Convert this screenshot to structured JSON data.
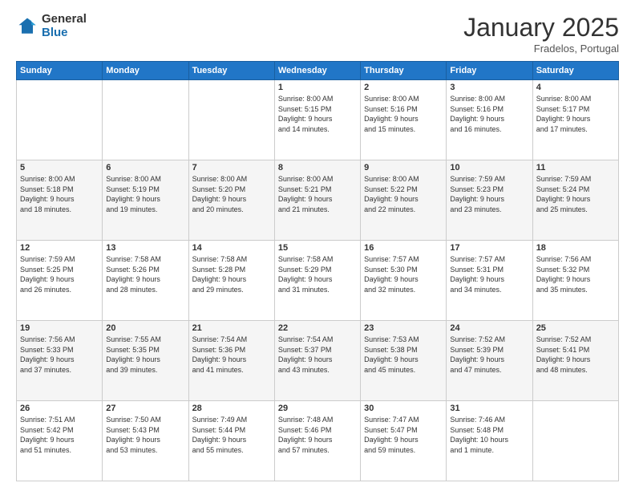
{
  "header": {
    "logo_general": "General",
    "logo_blue": "Blue",
    "month_title": "January 2025",
    "location": "Fradelos, Portugal"
  },
  "days_of_week": [
    "Sunday",
    "Monday",
    "Tuesday",
    "Wednesday",
    "Thursday",
    "Friday",
    "Saturday"
  ],
  "weeks": [
    [
      {
        "day": "",
        "info": ""
      },
      {
        "day": "",
        "info": ""
      },
      {
        "day": "",
        "info": ""
      },
      {
        "day": "1",
        "info": "Sunrise: 8:00 AM\nSunset: 5:15 PM\nDaylight: 9 hours\nand 14 minutes."
      },
      {
        "day": "2",
        "info": "Sunrise: 8:00 AM\nSunset: 5:16 PM\nDaylight: 9 hours\nand 15 minutes."
      },
      {
        "day": "3",
        "info": "Sunrise: 8:00 AM\nSunset: 5:16 PM\nDaylight: 9 hours\nand 16 minutes."
      },
      {
        "day": "4",
        "info": "Sunrise: 8:00 AM\nSunset: 5:17 PM\nDaylight: 9 hours\nand 17 minutes."
      }
    ],
    [
      {
        "day": "5",
        "info": "Sunrise: 8:00 AM\nSunset: 5:18 PM\nDaylight: 9 hours\nand 18 minutes."
      },
      {
        "day": "6",
        "info": "Sunrise: 8:00 AM\nSunset: 5:19 PM\nDaylight: 9 hours\nand 19 minutes."
      },
      {
        "day": "7",
        "info": "Sunrise: 8:00 AM\nSunset: 5:20 PM\nDaylight: 9 hours\nand 20 minutes."
      },
      {
        "day": "8",
        "info": "Sunrise: 8:00 AM\nSunset: 5:21 PM\nDaylight: 9 hours\nand 21 minutes."
      },
      {
        "day": "9",
        "info": "Sunrise: 8:00 AM\nSunset: 5:22 PM\nDaylight: 9 hours\nand 22 minutes."
      },
      {
        "day": "10",
        "info": "Sunrise: 7:59 AM\nSunset: 5:23 PM\nDaylight: 9 hours\nand 23 minutes."
      },
      {
        "day": "11",
        "info": "Sunrise: 7:59 AM\nSunset: 5:24 PM\nDaylight: 9 hours\nand 25 minutes."
      }
    ],
    [
      {
        "day": "12",
        "info": "Sunrise: 7:59 AM\nSunset: 5:25 PM\nDaylight: 9 hours\nand 26 minutes."
      },
      {
        "day": "13",
        "info": "Sunrise: 7:58 AM\nSunset: 5:26 PM\nDaylight: 9 hours\nand 28 minutes."
      },
      {
        "day": "14",
        "info": "Sunrise: 7:58 AM\nSunset: 5:28 PM\nDaylight: 9 hours\nand 29 minutes."
      },
      {
        "day": "15",
        "info": "Sunrise: 7:58 AM\nSunset: 5:29 PM\nDaylight: 9 hours\nand 31 minutes."
      },
      {
        "day": "16",
        "info": "Sunrise: 7:57 AM\nSunset: 5:30 PM\nDaylight: 9 hours\nand 32 minutes."
      },
      {
        "day": "17",
        "info": "Sunrise: 7:57 AM\nSunset: 5:31 PM\nDaylight: 9 hours\nand 34 minutes."
      },
      {
        "day": "18",
        "info": "Sunrise: 7:56 AM\nSunset: 5:32 PM\nDaylight: 9 hours\nand 35 minutes."
      }
    ],
    [
      {
        "day": "19",
        "info": "Sunrise: 7:56 AM\nSunset: 5:33 PM\nDaylight: 9 hours\nand 37 minutes."
      },
      {
        "day": "20",
        "info": "Sunrise: 7:55 AM\nSunset: 5:35 PM\nDaylight: 9 hours\nand 39 minutes."
      },
      {
        "day": "21",
        "info": "Sunrise: 7:54 AM\nSunset: 5:36 PM\nDaylight: 9 hours\nand 41 minutes."
      },
      {
        "day": "22",
        "info": "Sunrise: 7:54 AM\nSunset: 5:37 PM\nDaylight: 9 hours\nand 43 minutes."
      },
      {
        "day": "23",
        "info": "Sunrise: 7:53 AM\nSunset: 5:38 PM\nDaylight: 9 hours\nand 45 minutes."
      },
      {
        "day": "24",
        "info": "Sunrise: 7:52 AM\nSunset: 5:39 PM\nDaylight: 9 hours\nand 47 minutes."
      },
      {
        "day": "25",
        "info": "Sunrise: 7:52 AM\nSunset: 5:41 PM\nDaylight: 9 hours\nand 48 minutes."
      }
    ],
    [
      {
        "day": "26",
        "info": "Sunrise: 7:51 AM\nSunset: 5:42 PM\nDaylight: 9 hours\nand 51 minutes."
      },
      {
        "day": "27",
        "info": "Sunrise: 7:50 AM\nSunset: 5:43 PM\nDaylight: 9 hours\nand 53 minutes."
      },
      {
        "day": "28",
        "info": "Sunrise: 7:49 AM\nSunset: 5:44 PM\nDaylight: 9 hours\nand 55 minutes."
      },
      {
        "day": "29",
        "info": "Sunrise: 7:48 AM\nSunset: 5:46 PM\nDaylight: 9 hours\nand 57 minutes."
      },
      {
        "day": "30",
        "info": "Sunrise: 7:47 AM\nSunset: 5:47 PM\nDaylight: 9 hours\nand 59 minutes."
      },
      {
        "day": "31",
        "info": "Sunrise: 7:46 AM\nSunset: 5:48 PM\nDaylight: 10 hours\nand 1 minute."
      },
      {
        "day": "",
        "info": ""
      }
    ]
  ]
}
